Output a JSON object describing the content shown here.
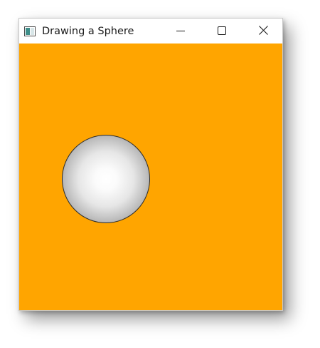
{
  "window": {
    "title": "Drawing a Sphere",
    "background_color": "#ffa500",
    "icons": {
      "app": "app-window-icon",
      "minimize": "minimize-icon",
      "maximize": "maximize-icon",
      "close": "close-icon"
    }
  },
  "scene": {
    "shape": "sphere",
    "fill": "radial-gradient white to dark gray",
    "stroke_color": "#2a2a2a"
  }
}
